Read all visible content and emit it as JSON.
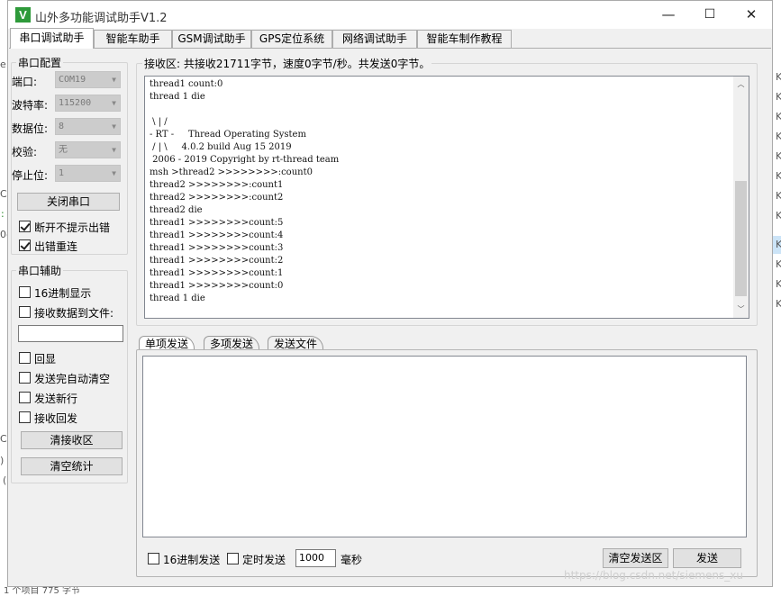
{
  "window": {
    "title": "山外多功能调试助手V1.2",
    "icon_letter": "V",
    "minimize_glyph": "—",
    "maximize_glyph": "☐",
    "close_glyph": "✕"
  },
  "tabs": [
    "串口调试助手",
    "智能车助手",
    "GSM调试助手",
    "GPS定位系统",
    "网络调试助手",
    "智能车制作教程"
  ],
  "serial_config": {
    "legend": "串口配置",
    "port_label": "端口:",
    "port_value": "COM19",
    "baud_label": "波特率:",
    "baud_value": "115200",
    "databits_label": "数据位:",
    "databits_value": "8",
    "parity_label": "校验:",
    "parity_value": "无",
    "stopbits_label": "停止位:",
    "stopbits_value": "1",
    "close_port_button": "关闭串口",
    "no_error_prompt_label": "断开不提示出错",
    "reconnect_on_error_label": "出错重连"
  },
  "serial_assist": {
    "legend": "串口辅助",
    "hex_display_label": "16进制显示",
    "save_to_file_label": "接收数据到文件:",
    "file_path_value": "",
    "echo_label": "回显",
    "auto_clear_label": "发送完自动清空",
    "send_newline_label": "发送新行",
    "recv_resend_label": "接收回发",
    "clear_recv_button": "清接收区",
    "clear_stats_button": "清空统计"
  },
  "receive": {
    "status": "接收区: 共接收21711字节，速度0字节/秒。共发送0字节。",
    "lines": [
      "thread1 count:0",
      "thread 1 die",
      "",
      " \\ | /",
      "- RT -     Thread Operating System",
      " / | \\     4.0.2 build Aug 15 2019",
      " 2006 - 2019 Copyright by rt-thread team",
      "msh >thread2 >>>>>>>>:count0",
      "thread2 >>>>>>>>:count1",
      "thread2 >>>>>>>>:count2",
      "thread2 die",
      "thread1 >>>>>>>>count:5",
      "thread1 >>>>>>>>count:4",
      "thread1 >>>>>>>>count:3",
      "thread1 >>>>>>>>count:2",
      "thread1 >>>>>>>>count:1",
      "thread1 >>>>>>>>count:0",
      "thread 1 die"
    ]
  },
  "send": {
    "tabs": [
      "单项发送",
      "多项发送",
      "发送文件"
    ],
    "text_value": "",
    "hex_send_label": "16进制发送",
    "timed_send_label": "定时发送",
    "interval_value": "1000",
    "interval_unit": "毫秒",
    "clear_send_button": "清空发送区",
    "send_button": "发送"
  },
  "background": {
    "left_chars": [
      "e",
      "C",
      ":",
      "0-",
      "C",
      ")",
      "("
    ],
    "right_chars": [
      "K",
      "K",
      "K",
      "K",
      "K",
      "K",
      "K",
      "K",
      "K",
      "K",
      "K",
      "K"
    ],
    "bottom_text": "1 个项目  775 字节"
  },
  "watermark": "https://blog.csdn.net/siemens_xu"
}
